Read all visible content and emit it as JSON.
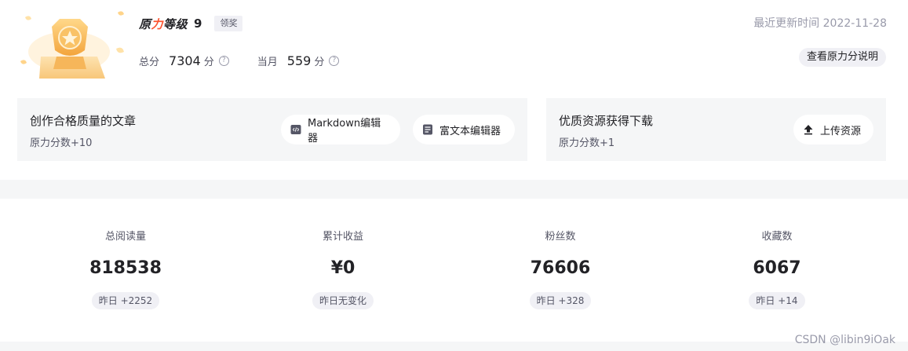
{
  "level": {
    "title_part1": "原",
    "title_accent": "力",
    "title_part2": "等级",
    "number": "9",
    "claim_label": "领奖"
  },
  "update_time": "最近更新时间 2022-11-28",
  "scores": {
    "total_label": "总分",
    "total_value": "7304",
    "month_label": "当月",
    "month_value": "559",
    "unit": "分",
    "help": "?"
  },
  "explain_button": "查看原力分说明",
  "article_panel": {
    "title": "创作合格质量的文章",
    "subtitle": "原力分数+10",
    "markdown_button": "Markdown编辑器",
    "richtext_button": "富文本编辑器"
  },
  "resource_panel": {
    "title": "优质资源获得下载",
    "subtitle": "原力分数+1",
    "upload_button": "上传资源"
  },
  "stats": [
    {
      "label": "总阅读量",
      "value": "818538",
      "delta": "昨日 +2252"
    },
    {
      "label": "累计收益",
      "value": "¥0",
      "delta": "昨日无变化"
    },
    {
      "label": "粉丝数",
      "value": "76606",
      "delta": "昨日 +328"
    },
    {
      "label": "收藏数",
      "value": "6067",
      "delta": "昨日 +14"
    }
  ],
  "watermark": "CSDN @libin9iOak",
  "colors": {
    "accent": "#fc5531",
    "medal": "#f5b04f",
    "panel_bg": "#f5f6f7"
  },
  "icons": {
    "medal": "medal-icon",
    "help": "question-circle-icon",
    "markdown": "code-doc-icon",
    "richtext": "rich-doc-icon",
    "upload": "upload-icon"
  }
}
